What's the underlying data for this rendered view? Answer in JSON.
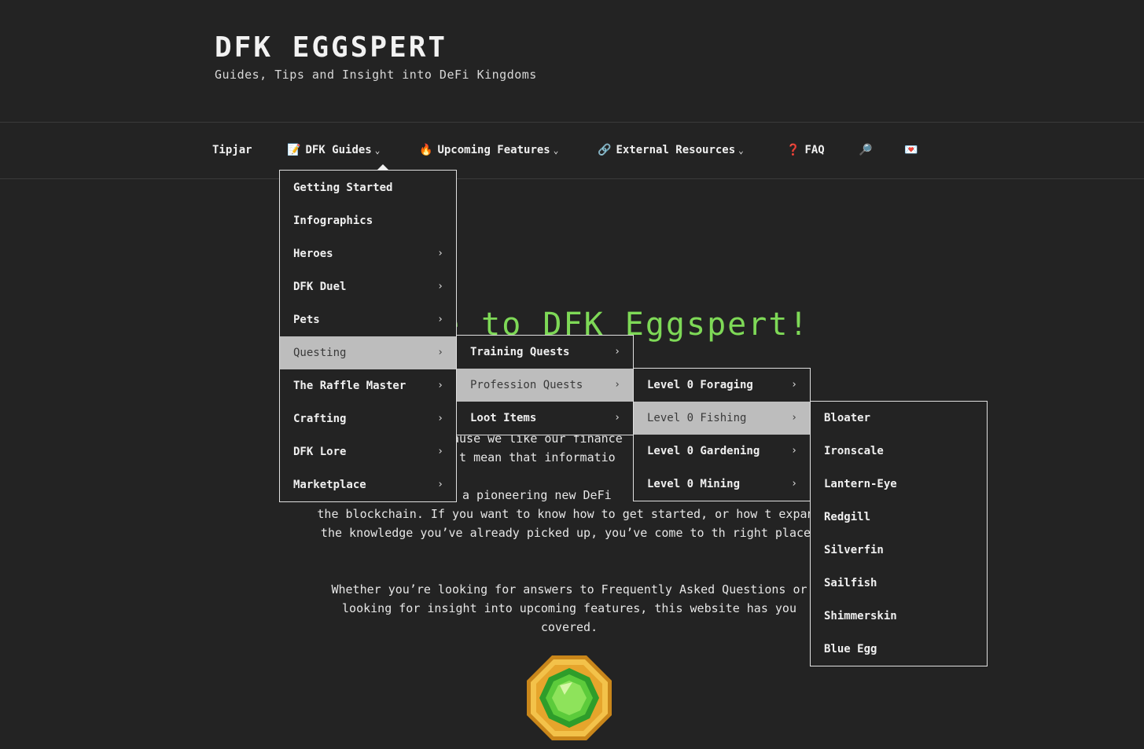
{
  "site": {
    "title": "DFK EGGSPERT",
    "description": "Guides, Tips and Insight into DeFi Kingdoms"
  },
  "nav": {
    "tipjar": "Tipjar",
    "dfk_guides": "DFK Guides",
    "upcoming_features": "Upcoming Features",
    "external_resources": "External Resources",
    "faq": "FAQ",
    "icons": {
      "guides": "memo-icon",
      "upcoming": "fire-icon",
      "external": "link-icon",
      "faq": "question-mark-icon",
      "search": "magnifier-icon",
      "mail": "love-letter-icon"
    }
  },
  "menu_guides": {
    "items": [
      {
        "label": "Getting Started"
      },
      {
        "label": "Infographics"
      },
      {
        "label": "Heroes"
      },
      {
        "label": "DFK Duel"
      },
      {
        "label": "Pets"
      },
      {
        "label": "Questing"
      },
      {
        "label": "The Raffle Master"
      },
      {
        "label": "Crafting"
      },
      {
        "label": "DFK Lore"
      },
      {
        "label": "Marketplace"
      }
    ]
  },
  "menu_questing": {
    "items": [
      {
        "label": "Training Quests"
      },
      {
        "label": "Profession Quests"
      },
      {
        "label": "Loot Items"
      }
    ]
  },
  "menu_profession": {
    "items": [
      {
        "label": "Level 0 Foraging"
      },
      {
        "label": "Level 0 Fishing"
      },
      {
        "label": "Level 0 Gardening"
      },
      {
        "label": "Level 0 Mining"
      }
    ]
  },
  "menu_fishing": {
    "items": [
      {
        "label": "Bloater"
      },
      {
        "label": "Ironscale"
      },
      {
        "label": "Lantern-Eye"
      },
      {
        "label": "Redgill"
      },
      {
        "label": "Silverfin"
      },
      {
        "label": "Sailfish"
      },
      {
        "label": "Shimmerskin"
      },
      {
        "label": "Blue Egg"
      }
    ]
  },
  "content": {
    "heading_fragment": "e to DFK Eggspert!",
    "para1_line1": "ause we like our finance",
    "para1_line2": "’t mean that informatio",
    "para2_fragment": "a pioneering new DeFi",
    "para2_rest": "the blockchain. If you want to know how to get started, or how t expand the knowledge you’ve already picked up, you’ve come to th right place!",
    "para3": "Whether you’re looking for answers to Frequently Asked Questions or looking for insight into upcoming features, this website has you covered."
  },
  "colors": {
    "background": "#232323",
    "accent_green": "#7ed957",
    "menu_active": "#bdbdbd"
  }
}
